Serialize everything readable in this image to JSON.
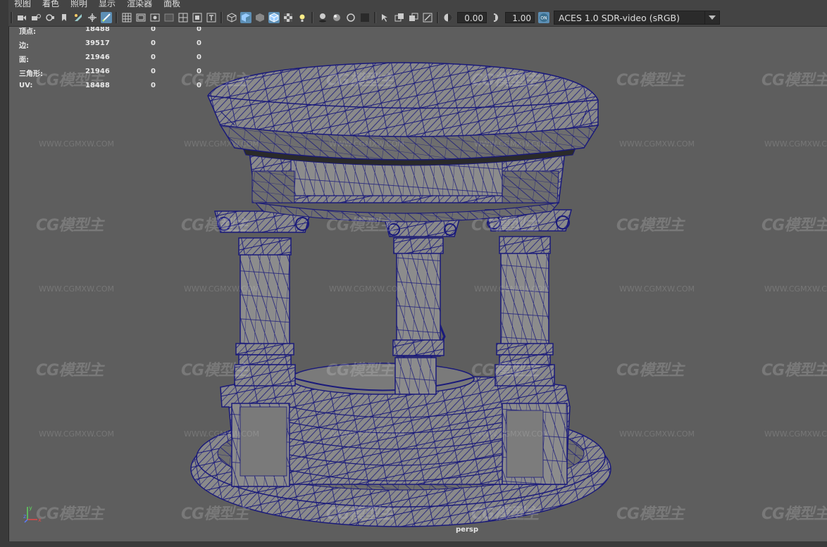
{
  "menubar": {
    "items": [
      "视图",
      "着色",
      "照明",
      "显示",
      "渲染器",
      "面板"
    ]
  },
  "toolbar": {
    "exposure_value": "0.00",
    "gamma_value": "1.00",
    "colorspace_selected": "ACES 1.0 SDR-video (sRGB)",
    "icons": [
      "select-camera-icon",
      "camera-attributes-icon",
      "bookmark-icon",
      "image-plane-icon",
      "grid-icon",
      "film-gate-icon",
      "resolution-gate-icon",
      "wireframe-icon",
      "smooth-shade-icon",
      "textured-icon",
      "use-lights-icon",
      "shadows-icon",
      "isolate-select-icon",
      "xray-icon",
      "exposure-icon",
      "gamma-icon",
      "color-management-icon"
    ]
  },
  "hud": {
    "rows": [
      {
        "label": "顶点:",
        "v1": "18488",
        "v2": "0",
        "v3": "0"
      },
      {
        "label": "边:",
        "v1": "39517",
        "v2": "0",
        "v3": "0"
      },
      {
        "label": "面:",
        "v1": "21946",
        "v2": "0",
        "v3": "0"
      },
      {
        "label": "三角形:",
        "v1": "21946",
        "v2": "0",
        "v3": "0"
      },
      {
        "label": "UV:",
        "v1": "18488",
        "v2": "0",
        "v3": "0"
      }
    ]
  },
  "viewport": {
    "camera_label": "persp"
  },
  "watermark": {
    "logo": "CG模型主",
    "url": "WWW.CGMXW.COM"
  },
  "axis": {
    "x": "x",
    "y": "y",
    "z": "z"
  },
  "colors": {
    "wire": "#1a1a7a",
    "mesh": "#8a8a8a",
    "background": "#5e5e5e",
    "active": "#5d8fb5"
  }
}
